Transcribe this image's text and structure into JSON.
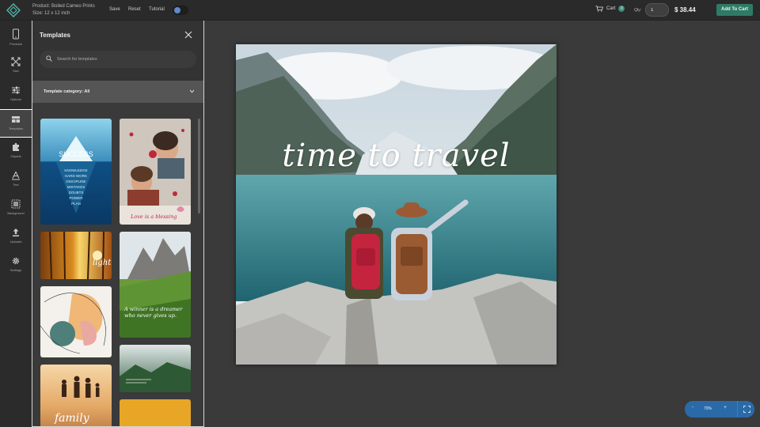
{
  "topbar": {
    "product_line": "Product: Boiled Cameo Prints",
    "size_line": "Size: 12 x 12 inch",
    "save_label": "Save",
    "reset_label": "Reset",
    "tutorial_label": "Tutorial",
    "cart_label": "Cart",
    "cart_count": "0",
    "qty_label": "Qty:",
    "qty_value": "1",
    "price": "$ 38.44",
    "add_to_cart_label": "Add To Cart"
  },
  "sidebar": {
    "items": [
      {
        "label": "Products",
        "icon": "phone-icon"
      },
      {
        "label": "Size",
        "icon": "resize-icon"
      },
      {
        "label": "Options",
        "icon": "sliders-icon"
      },
      {
        "label": "Templates",
        "icon": "templates-icon"
      },
      {
        "label": "Cliparts",
        "icon": "puzzle-icon"
      },
      {
        "label": "Text",
        "icon": "text-icon"
      },
      {
        "label": "Background",
        "icon": "background-icon"
      },
      {
        "label": "Uploads",
        "icon": "upload-icon"
      },
      {
        "label": "Settings",
        "icon": "gear-icon"
      }
    ]
  },
  "panel": {
    "title": "Templates",
    "search_placeholder": "Search for templates",
    "category_label": "Template category: All",
    "templates": [
      {
        "caption": "SUCCESS",
        "lines": [
          "KNOWLEDGE",
          "HARD WORK",
          "DISCIPLINE",
          "MISTAKES",
          "DOUBTS",
          "POWER",
          "PLAN"
        ]
      },
      {
        "caption": "Love is a blessing"
      },
      {
        "caption": "light"
      },
      {
        "caption": "A winner is a dreamer who never gives up."
      },
      {
        "caption": ""
      },
      {
        "caption": ""
      },
      {
        "caption": "family"
      },
      {
        "caption": ""
      }
    ]
  },
  "canvas": {
    "headline": "time to travel"
  },
  "zoom": {
    "minus": "-",
    "value": "70%",
    "plus": "+"
  },
  "colors": {
    "accent": "#2f7a66",
    "zoom": "#2a6aa8"
  }
}
